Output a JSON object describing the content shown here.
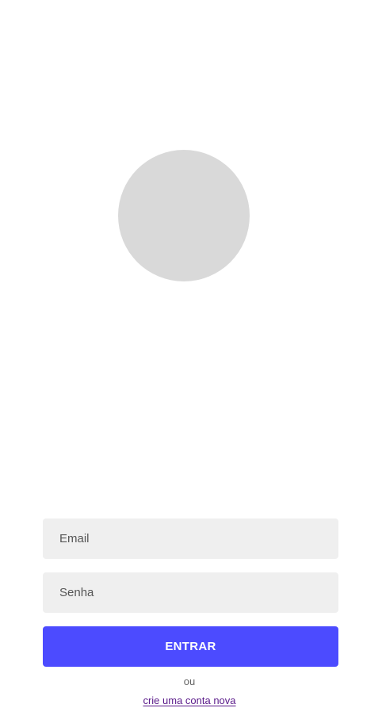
{
  "avatar": {
    "color": "#d9d9d9"
  },
  "form": {
    "email_placeholder": "Email",
    "password_placeholder": "Senha",
    "login_button_label": "ENTRAR",
    "login_button_color": "#4c4bff",
    "or_text": "ou",
    "signup_link_label": "crie uma conta nova",
    "link_color": "#5a1a8a"
  }
}
